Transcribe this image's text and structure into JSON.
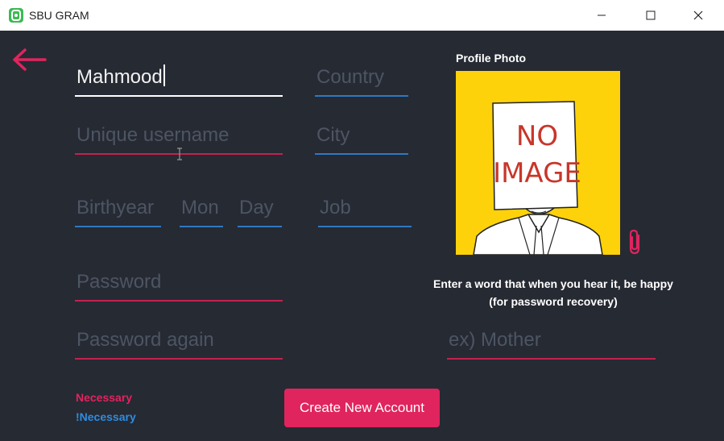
{
  "window": {
    "title": "SBU GRAM",
    "controls": {
      "minimize": "–",
      "maximize": "☐",
      "close": "✕"
    }
  },
  "form": {
    "name": {
      "value": "Mahmood"
    },
    "username": {
      "placeholder": "Unique username"
    },
    "birthyear": {
      "placeholder": "Birthyear"
    },
    "month": {
      "placeholder": "Mon"
    },
    "day": {
      "placeholder": "Day"
    },
    "password": {
      "placeholder": "Password"
    },
    "password_again": {
      "placeholder": "Password again"
    },
    "country": {
      "placeholder": "Country"
    },
    "city": {
      "placeholder": "City"
    },
    "job": {
      "placeholder": "Job"
    },
    "recovery": {
      "placeholder": "ex) Mother"
    }
  },
  "profile": {
    "label": "Profile Photo",
    "image_text": [
      "NO",
      "IMAGE"
    ]
  },
  "recovery_hint": {
    "line1": "Enter a word that when you hear it, be happy",
    "line2": "(for password recovery)"
  },
  "legend": {
    "necessary": "Necessary",
    "optional": "!Necessary"
  },
  "create_button": "Create New Account",
  "colors": {
    "background": "#262a33",
    "accent_red": "#e0245e",
    "accent_blue": "#2f8ce0",
    "photo_bg": "#fdd20a"
  }
}
